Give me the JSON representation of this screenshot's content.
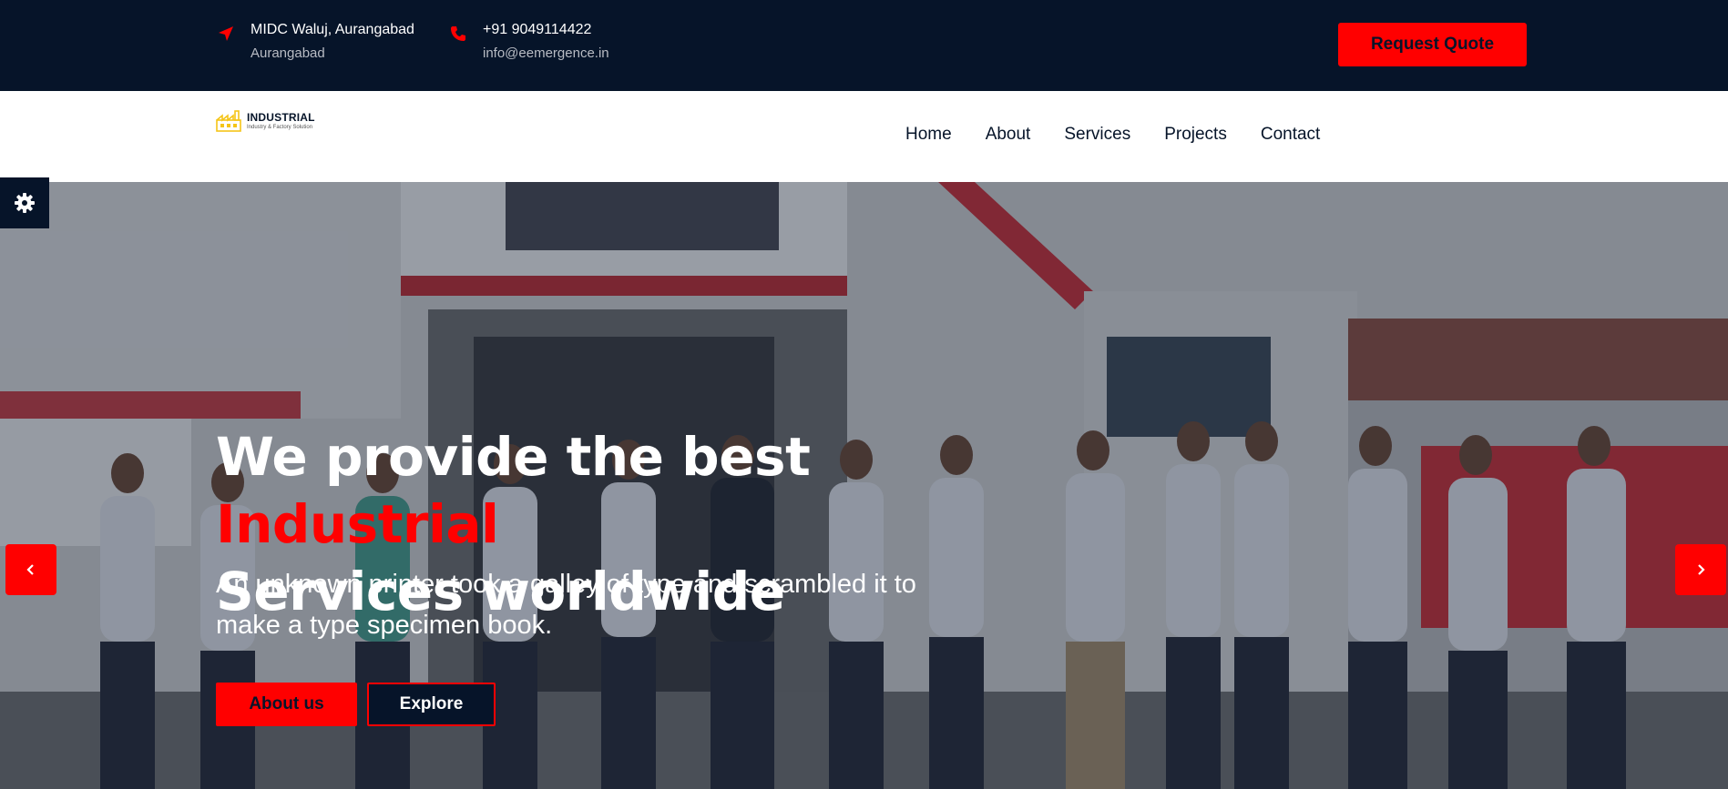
{
  "topbar": {
    "address_line1": "MIDC Waluj, Aurangabad",
    "address_line2": "Aurangabad",
    "phone": "+91 9049114422",
    "email": "info@eemergence.in",
    "request_quote_label": "Request Quote"
  },
  "logo": {
    "title": "INDUSTRIAL",
    "subtitle": "Industry & Factory Solution"
  },
  "nav": {
    "items": [
      "Home",
      "About",
      "Services",
      "Projects",
      "Contact"
    ]
  },
  "hero": {
    "title_part1": "We provide the best ",
    "title_accent": "Industrial",
    "title_part2": "Services worldwide",
    "subtitle": "An unknown printer took a galley of type and scrambled it to make a type specimen book.",
    "about_label": "About us",
    "explore_label": "Explore"
  },
  "icons": {
    "address": "location-arrow-icon",
    "phone": "phone-icon",
    "settings": "gear-icon",
    "prev": "chevron-left-icon",
    "next": "chevron-right-icon"
  },
  "colors": {
    "dark": "#061429",
    "accent": "#ff0000",
    "white": "#ffffff"
  }
}
